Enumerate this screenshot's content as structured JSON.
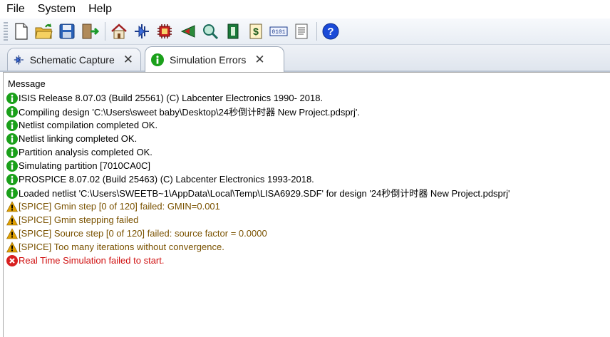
{
  "menu": {
    "items": [
      "File",
      "System",
      "Help"
    ]
  },
  "toolbar": {
    "buttons": [
      {
        "icon": "new-file-icon"
      },
      {
        "icon": "open-folder-icon"
      },
      {
        "icon": "save-icon"
      },
      {
        "icon": "exit-icon"
      },
      {
        "icon": "home-icon"
      },
      {
        "icon": "schematic-icon"
      },
      {
        "icon": "pcb-chip-icon"
      },
      {
        "icon": "3d-viewer-icon"
      },
      {
        "icon": "gerber-viewer-icon"
      },
      {
        "icon": "design-explorer-icon"
      },
      {
        "icon": "bill-of-materials-icon"
      },
      {
        "icon": "source-code-icon"
      },
      {
        "icon": "notes-icon"
      },
      {
        "icon": "help-icon"
      }
    ]
  },
  "tabs": [
    {
      "label": "Schematic Capture",
      "icon": "schematic-tab-icon",
      "active": false
    },
    {
      "label": "Simulation Errors",
      "icon": "info-icon",
      "active": true
    }
  ],
  "messages": {
    "header": "Message",
    "rows": [
      {
        "level": "info",
        "text": "ISIS Release 8.07.03 (Build 25561) (C) Labcenter Electronics 1990- 2018."
      },
      {
        "level": "info",
        "text": "Compiling design 'C:\\Users\\sweet baby\\Desktop\\24秒倒计时器 New Project.pdsprj'."
      },
      {
        "level": "info",
        "text": "Netlist compilation completed OK."
      },
      {
        "level": "info",
        "text": "Netlist linking completed OK."
      },
      {
        "level": "info",
        "text": "Partition analysis completed OK."
      },
      {
        "level": "info",
        "text": "Simulating partition [7010CA0C]"
      },
      {
        "level": "info",
        "text": "PROSPICE 8.07.02 (Build 25463) (C) Labcenter Electronics 1993-2018."
      },
      {
        "level": "info",
        "text": "Loaded netlist 'C:\\Users\\SWEETB~1\\AppData\\Local\\Temp\\LISA6929.SDF' for design '24秒倒计时器 New Project.pdsprj'"
      },
      {
        "level": "warn",
        "text": "[SPICE] Gmin step [0 of 120] failed: GMIN=0.001"
      },
      {
        "level": "warn",
        "text": "[SPICE] Gmin stepping failed"
      },
      {
        "level": "warn",
        "text": "[SPICE] Source step [0 of 120] failed: source factor =   0.0000"
      },
      {
        "level": "warn",
        "text": "[SPICE] Too many iterations without convergence."
      },
      {
        "level": "error",
        "text": "Real Time Simulation failed to start."
      }
    ]
  },
  "colors": {
    "info": "#1aa01a",
    "warn": "#e0a000",
    "error": "#d82020"
  }
}
